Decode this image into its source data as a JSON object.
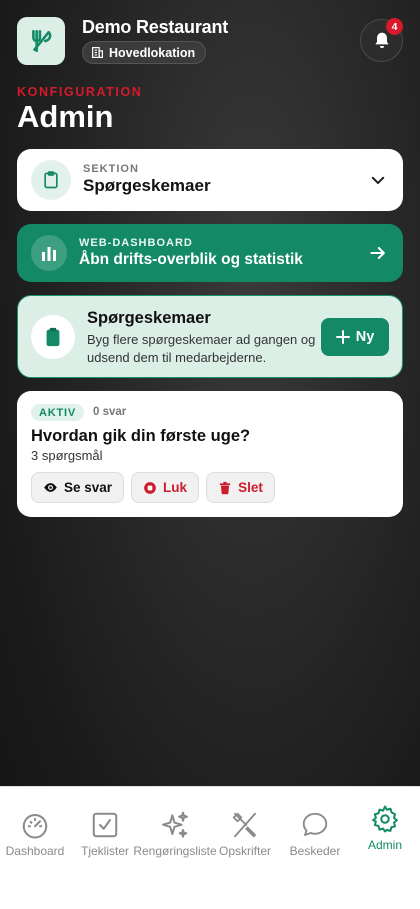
{
  "header": {
    "restaurant_name": "Demo Restaurant",
    "location": "Hovedlokation",
    "notification_count": "4"
  },
  "page": {
    "kicker": "KONFIGURATION",
    "title": "Admin"
  },
  "section_select": {
    "kicker": "SEKTION",
    "value": "Spørgeskemaer"
  },
  "web_dashboard": {
    "kicker": "WEB-DASHBOARD",
    "title": "Åbn drifts-overblik og statistik"
  },
  "info": {
    "title": "Spørgeskemaer",
    "description": "Byg flere spørgeskemaer ad gangen og udsend dem til medarbejderne.",
    "new_label": "Ny"
  },
  "surveys": [
    {
      "status": "AKTIV",
      "answers": "0 svar",
      "title": "Hvordan gik din første uge?",
      "question_count": "3 spørgsmål",
      "view_label": "Se svar",
      "close_label": "Luk",
      "delete_label": "Slet"
    }
  ],
  "tabs": [
    {
      "label": "Dashboard",
      "icon": "gauge-icon"
    },
    {
      "label": "Tjeklister",
      "icon": "checkbox-icon"
    },
    {
      "label": "Rengøringsliste",
      "icon": "sparkles-icon"
    },
    {
      "label": "Opskrifter",
      "icon": "utensils-icon"
    },
    {
      "label": "Beskeder",
      "icon": "chat-icon"
    },
    {
      "label": "Admin",
      "icon": "gear-icon"
    }
  ],
  "colors": {
    "accent": "#138a65",
    "danger": "#d7192b",
    "card_tint": "#dcefe7"
  }
}
